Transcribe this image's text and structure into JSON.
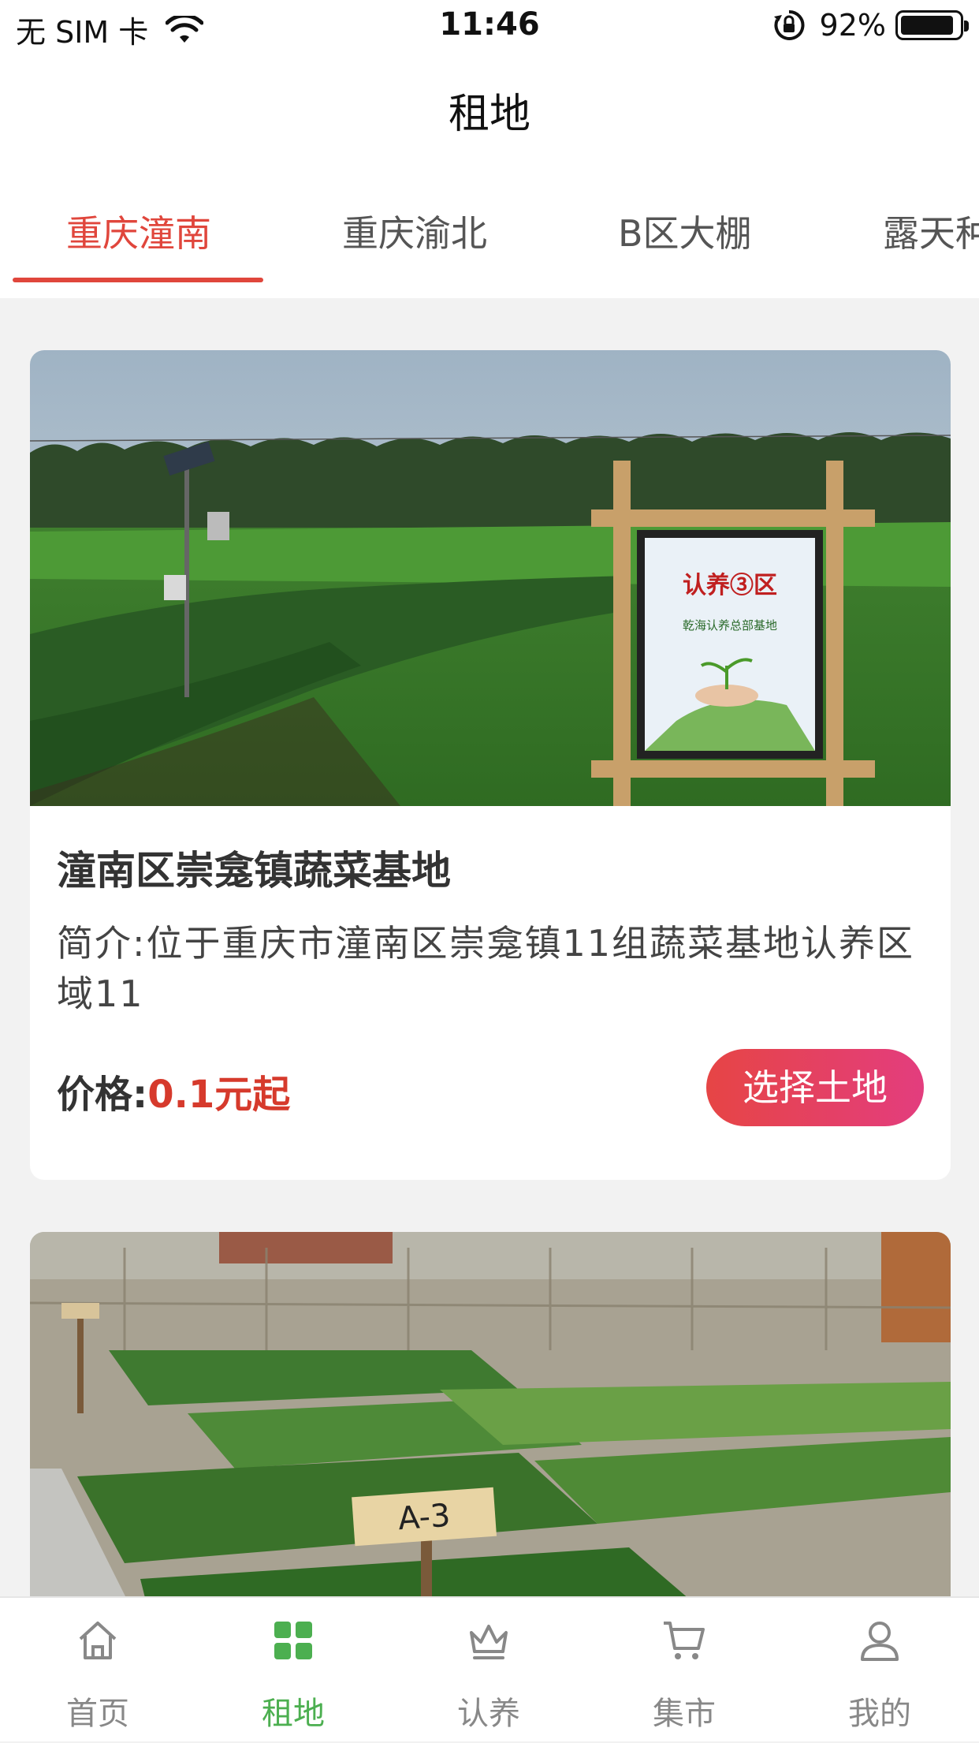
{
  "status_bar": {
    "carrier": "无 SIM 卡",
    "time": "11:46",
    "battery": "92%",
    "battery_level": 0.92
  },
  "nav": {
    "title": "租地"
  },
  "tabs": [
    {
      "label": "重庆潼南",
      "active": true
    },
    {
      "label": "重庆渝北",
      "active": false
    },
    {
      "label": "B区大棚",
      "active": false
    },
    {
      "label": "露天种",
      "active": false
    }
  ],
  "cards": [
    {
      "image": "field-with-sign",
      "sign_text_title": "认养③区",
      "sign_text_sub": "乾海认养总部基地",
      "title": "潼南区崇龛镇蔬菜基地",
      "desc": "简介:位于重庆市潼南区崇龛镇11组蔬菜基地认养区域11",
      "price_label": "价格:",
      "price_value": "0.1元起",
      "button": "选择土地"
    },
    {
      "image": "vegetable-plots",
      "plot_sign": "A-3"
    }
  ],
  "tabbar": [
    {
      "label": "首页",
      "icon": "home-icon",
      "active": false
    },
    {
      "label": "租地",
      "icon": "grid-icon",
      "active": true
    },
    {
      "label": "认养",
      "icon": "crown-icon",
      "active": false
    },
    {
      "label": "集市",
      "icon": "cart-icon",
      "active": false
    },
    {
      "label": "我的",
      "icon": "user-icon",
      "active": false
    }
  ],
  "colors": {
    "accent_red": "#e0463c",
    "price_red": "#d63a2c",
    "active_green": "#4caf50",
    "button_gradient_start": "#e64545",
    "button_gradient_end": "#e33d7e"
  }
}
